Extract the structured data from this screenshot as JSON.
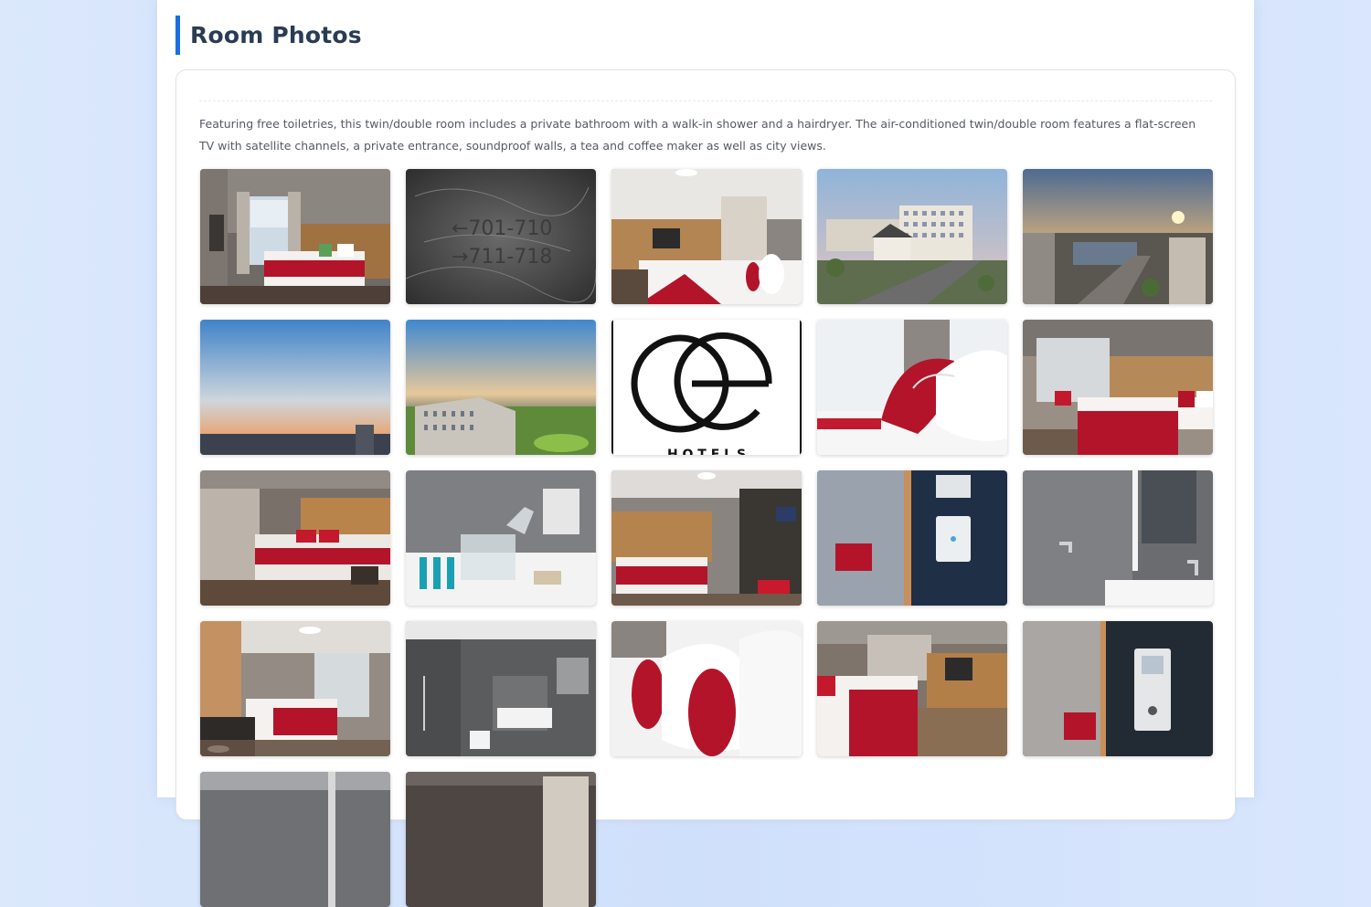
{
  "section": {
    "title": "Room Photos"
  },
  "description": "Featuring free toiletries, this twin/double room includes a private bathroom with a walk-in shower and a hairdryer. The air-conditioned twin/double room features a flat-screen TV with satellite channels, a private entrance, soundproof walls, a tea and coffee maker as well as city views.",
  "sign": {
    "line1": "←701-710",
    "line2": "→711-718"
  },
  "logo": {
    "text": "H O T E L S"
  },
  "colors": {
    "accent": "#1a6fe0",
    "bedding_red": "#b3142a",
    "title": "#2a3c54"
  }
}
